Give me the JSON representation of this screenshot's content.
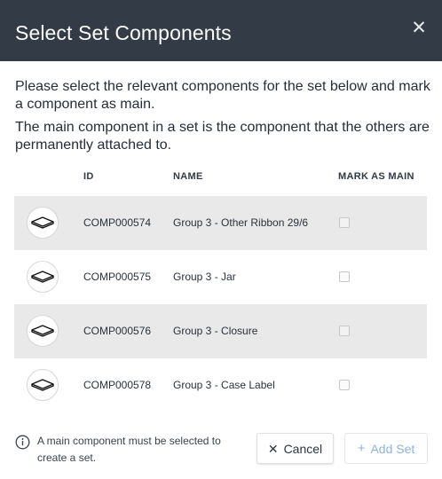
{
  "dialog": {
    "title": "Select Set Components",
    "close_icon": "close-icon",
    "intro_line1": "Please select the relevant components for the set below and mark a component as main.",
    "intro_line2": "The main component in a set is the component that the others are permanently attached to."
  },
  "table": {
    "headers": {
      "id": "ID",
      "name": "NAME",
      "main": "MARK AS MAIN"
    },
    "rows": [
      {
        "id": "COMP000574",
        "name": "Group 3 - Other Ribbon 29/6",
        "icon": "label-shape-icon",
        "checked": false
      },
      {
        "id": "COMP000575",
        "name": "Group 3 - Jar",
        "icon": "label-shape-icon",
        "checked": false
      },
      {
        "id": "COMP000576",
        "name": "Group 3 - Closure",
        "icon": "label-shape-icon",
        "checked": false
      },
      {
        "id": "COMP000578",
        "name": "Group 3 - Case Label",
        "icon": "label-shape-icon",
        "checked": false
      }
    ]
  },
  "footer": {
    "note": "A main component must be selected to create a set.",
    "note_icon": "info-icon",
    "cancel_label": "Cancel",
    "cancel_icon": "x-icon",
    "add_label": "Add Set",
    "add_icon": "plus-icon",
    "add_disabled": true
  },
  "colors": {
    "header_bg": "#333c46",
    "row_shade": "#e9e9e9",
    "add_button_text": "#8fb3de"
  }
}
